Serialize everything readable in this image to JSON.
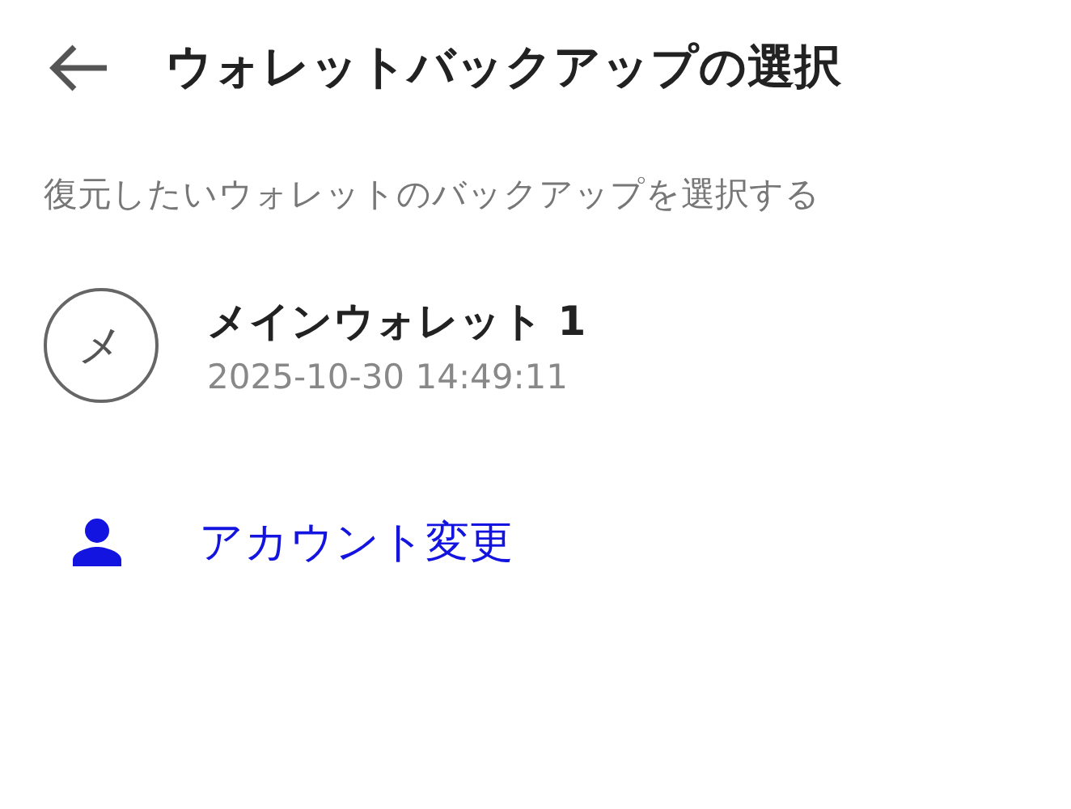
{
  "header": {
    "title": "ウォレットバックアップの選択"
  },
  "instruction": "復元したいウォレットのバックアップを選択する",
  "backups": [
    {
      "initial": "メ",
      "name": "メインウォレット 1",
      "date": "2025-10-30 14:49:11"
    }
  ],
  "account_link": {
    "label": "アカウント変更"
  }
}
